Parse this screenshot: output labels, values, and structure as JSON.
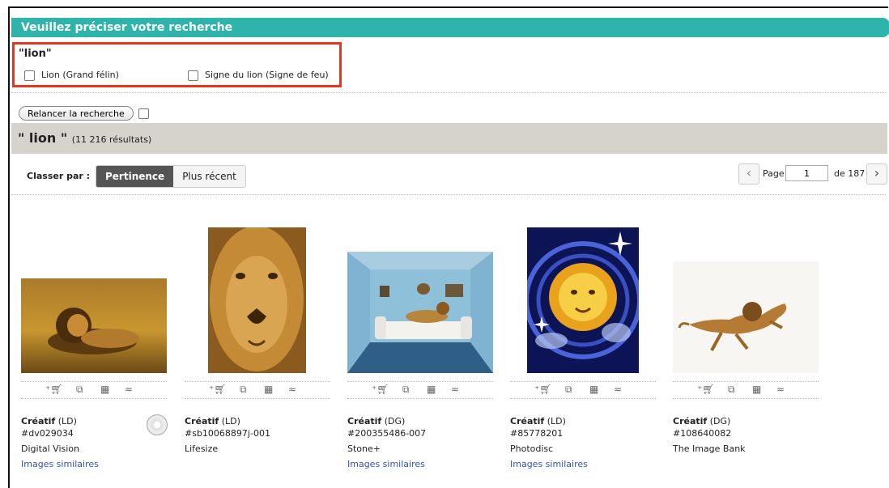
{
  "banner": {
    "title": "Veuillez préciser votre recherche"
  },
  "refine": {
    "query": "\"lion\"",
    "options": [
      "Lion (Grand félin)",
      "Signe du lion (Signe de feu)"
    ]
  },
  "relaunch": {
    "label": "Relancer la recherche"
  },
  "results": {
    "term": "\" lion \"",
    "count": "(11 216 résultats)"
  },
  "sort": {
    "label": "Classer par :",
    "options": [
      "Pertinence",
      "Plus récent"
    ],
    "selected": "Pertinence"
  },
  "pager": {
    "page_label": "Page",
    "current": "1",
    "of_label": "de 187"
  },
  "icon_names": [
    "add-to-cart-icon",
    "copy-icon",
    "calculator-icon",
    "similar-icon"
  ],
  "images": [
    {
      "type": "Créatif",
      "license": " (LD)",
      "id": "#dv029034",
      "source": "Digital Vision",
      "similar": "Images similaires"
    },
    {
      "type": "Créatif",
      "license": " (LD)",
      "id": "#sb10068897j-001",
      "source": "Lifesize",
      "similar": ""
    },
    {
      "type": "Créatif",
      "license": " (DG)",
      "id": "#200355486-007",
      "source": "Stone+",
      "similar": "Images similaires"
    },
    {
      "type": "Créatif",
      "license": " (LD)",
      "id": "#85778201",
      "source": "Photodisc",
      "similar": "Images similaires"
    },
    {
      "type": "Créatif",
      "license": " (DG)",
      "id": "#108640082",
      "source": "The Image Bank",
      "similar": ""
    }
  ]
}
